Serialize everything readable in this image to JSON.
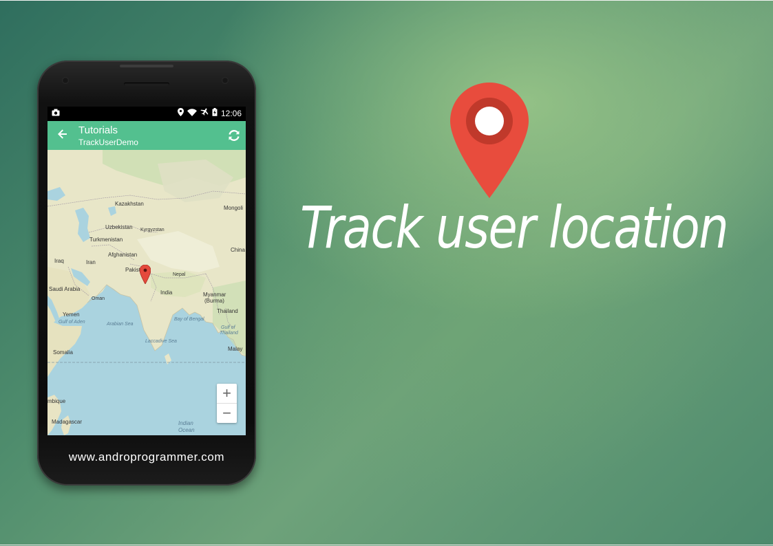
{
  "headline": "Track user location",
  "website": "www.androprogrammer.com",
  "status_bar": {
    "time": "12:06",
    "icons": [
      "screenshot-icon",
      "location-icon",
      "wifi-icon",
      "airplane-icon",
      "battery-icon"
    ]
  },
  "app_bar": {
    "title": "Tutorials",
    "subtitle": "TrackUserDemo",
    "back_icon": "arrow-back-icon",
    "action_icon": "refresh-icon"
  },
  "map": {
    "labels": {
      "kazakhstan": "Kazakhstan",
      "mongolia": "Mongoli",
      "uzbekistan": "Uzbekistan",
      "kyrgyzstan": "Kyrgyzstan",
      "turkmenistan": "Turkmenistan",
      "china": "China",
      "afghanistan": "Afghanistan",
      "iraq": "Iraq",
      "iran": "Iran",
      "pakistan": "Pakistan",
      "nepal": "Nepal",
      "saudi_arabia": "Saudi Arabia",
      "oman": "Oman",
      "india": "India",
      "myanmar": "Myanmar",
      "burma": "(Burma)",
      "yemen": "Yemen",
      "gulf_aden": "Gulf of Aden",
      "arabian_sea": "Arabian Sea",
      "bay_bengal": "Bay of Bengal",
      "thailand": "Thailand",
      "gulf_thailand_1": "Gulf of",
      "gulf_thailand_2": "Thailand",
      "laccadive_sea": "Laccadive Sea",
      "somalia": "Somalia",
      "malaysia": "Malay",
      "mozambique": "mbique",
      "madagascar": "Madagascar",
      "indian_ocean_1": "Indian",
      "indian_ocean_2": "Ocean"
    },
    "zoom_in": "+",
    "zoom_out": "−"
  },
  "colors": {
    "accent": "#53c08f",
    "pin": "#e4493c",
    "water": "#aad3df",
    "land": "#e8e6c8"
  }
}
